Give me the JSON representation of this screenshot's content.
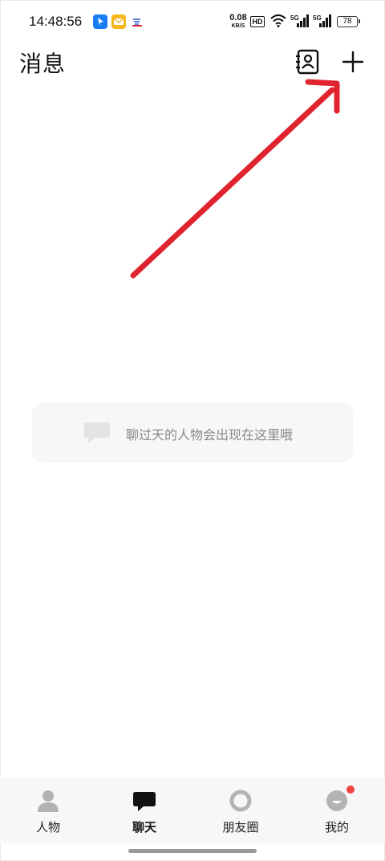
{
  "status_bar": {
    "time": "14:48:56",
    "net_speed": "0.08",
    "net_unit": "KB/S",
    "hd": "HD",
    "signal1": "5G",
    "signal2": "5G",
    "battery": "78",
    "notification_icons": [
      "location-app-icon",
      "mail-app-icon",
      "cloud-app-icon"
    ]
  },
  "header": {
    "title": "消息",
    "contacts_icon": "contacts-book-icon",
    "add_icon": "plus-icon"
  },
  "empty_state": {
    "hint": "聊过天的人物会出现在这里哦",
    "icon": "chat-bubble-icon"
  },
  "bottom_nav": {
    "items": [
      {
        "label": "人物",
        "icon": "person-icon"
      },
      {
        "label": "聊天",
        "icon": "chat-icon"
      },
      {
        "label": "朋友圈",
        "icon": "moments-ring-icon"
      },
      {
        "label": "我的",
        "icon": "profile-avatar-icon"
      }
    ],
    "active": "聊天"
  },
  "colors": {
    "accent_red": "#e0242f",
    "badge": "#ef4444",
    "nav_bg": "#f7f7f7",
    "hint_text": "#888888"
  }
}
